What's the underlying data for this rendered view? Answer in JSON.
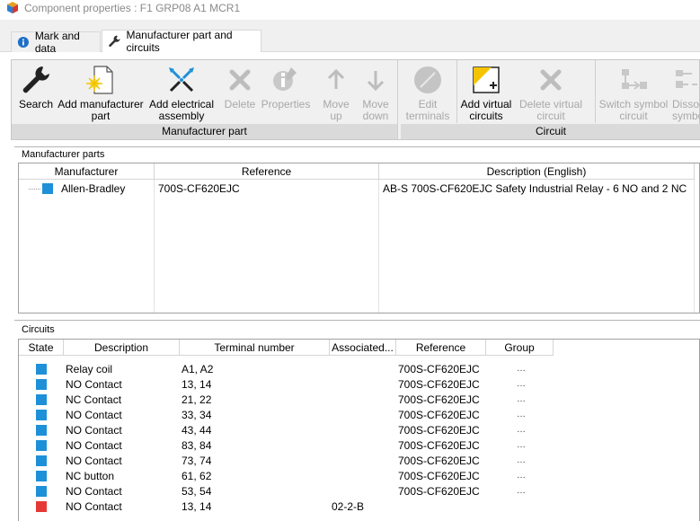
{
  "window": {
    "title": "Component properties : F1 GRP08 A1 MCR1"
  },
  "tabs": [
    {
      "label": "Mark and data",
      "icon": "info-icon"
    },
    {
      "label": "Manufacturer part and circuits",
      "icon": "wrench-icon"
    }
  ],
  "ribbon": {
    "groups": [
      {
        "caption": "Manufacturer part",
        "buttons": [
          {
            "label_line1": "Search",
            "label_line2": "",
            "icon": "wrench-icon",
            "enabled": true
          },
          {
            "label_line1": "Add manufacturer",
            "label_line2": "part",
            "icon": "add-part-icon",
            "enabled": true
          },
          {
            "label_line1": "Add electrical",
            "label_line2": "assembly",
            "icon": "assembly-icon",
            "enabled": true
          },
          {
            "label_line1": "Delete",
            "label_line2": "",
            "icon": "delete-icon",
            "enabled": false
          },
          {
            "label_line1": "Properties",
            "label_line2": "",
            "icon": "properties-icon",
            "enabled": false
          },
          {
            "label_line1": "Move",
            "label_line2": "up",
            "icon": "arrow-up-icon",
            "enabled": false
          },
          {
            "label_line1": "Move",
            "label_line2": "down",
            "icon": "arrow-down-icon",
            "enabled": false
          }
        ]
      },
      {
        "caption": "Circuit",
        "buttons": [
          {
            "label_line1": "Edit",
            "label_line2": "terminals",
            "icon": "edit-terminals-icon",
            "enabled": false
          },
          {
            "label_line1": "Add virtual",
            "label_line2": "circuits",
            "icon": "add-virtual-circuit-icon",
            "enabled": true
          },
          {
            "label_line1": "Delete virtual",
            "label_line2": "circuit",
            "icon": "delete-icon",
            "enabled": false
          },
          {
            "label_line1": "Switch symbol",
            "label_line2": "circuit",
            "icon": "switch-symbol-icon",
            "enabled": false
          },
          {
            "label_line1": "Dissoc",
            "label_line2": "symbol",
            "icon": "dissociate-icon",
            "enabled": false
          }
        ]
      }
    ]
  },
  "manufacturer_parts": {
    "section_title": "Manufacturer parts",
    "columns": [
      "Manufacturer",
      "Reference",
      "Description (English)"
    ],
    "rows": [
      {
        "manufacturer": "Allen-Bradley",
        "reference": "700S-CF620EJC",
        "description": "AB-S 700S-CF620EJC Safety Industrial Relay - 6 NO and 2 NC",
        "color": "#1e90d8"
      }
    ]
  },
  "circuits": {
    "section_title": "Circuits",
    "columns": [
      "State",
      "Description",
      "Terminal number",
      "Associated...",
      "Reference",
      "Group"
    ],
    "rows": [
      {
        "state_color": "#1e90d8",
        "description": "Relay coil",
        "terminal": "A1, A2",
        "associated": "",
        "reference": "700S-CF620EJC",
        "group": "…"
      },
      {
        "state_color": "#1e90d8",
        "description": "NO Contact",
        "terminal": "13, 14",
        "associated": "",
        "reference": "700S-CF620EJC",
        "group": "…"
      },
      {
        "state_color": "#1e90d8",
        "description": "NC Contact",
        "terminal": "21, 22",
        "associated": "",
        "reference": "700S-CF620EJC",
        "group": "…"
      },
      {
        "state_color": "#1e90d8",
        "description": "NO Contact",
        "terminal": "33, 34",
        "associated": "",
        "reference": "700S-CF620EJC",
        "group": "…"
      },
      {
        "state_color": "#1e90d8",
        "description": "NO Contact",
        "terminal": "43, 44",
        "associated": "",
        "reference": "700S-CF620EJC",
        "group": "…"
      },
      {
        "state_color": "#1e90d8",
        "description": "NO Contact",
        "terminal": "83, 84",
        "associated": "",
        "reference": "700S-CF620EJC",
        "group": "…"
      },
      {
        "state_color": "#1e90d8",
        "description": "NO Contact",
        "terminal": "73, 74",
        "associated": "",
        "reference": "700S-CF620EJC",
        "group": "…"
      },
      {
        "state_color": "#1e90d8",
        "description": "NC button",
        "terminal": "61, 62",
        "associated": "",
        "reference": "700S-CF620EJC",
        "group": "…"
      },
      {
        "state_color": "#1e90d8",
        "description": "NO Contact",
        "terminal": "53, 54",
        "associated": "",
        "reference": "700S-CF620EJC",
        "group": "…"
      },
      {
        "state_color": "#e53935",
        "description": "NO Contact",
        "terminal": "13, 14",
        "associated": "02-2-B",
        "reference": "",
        "group": ""
      }
    ]
  }
}
